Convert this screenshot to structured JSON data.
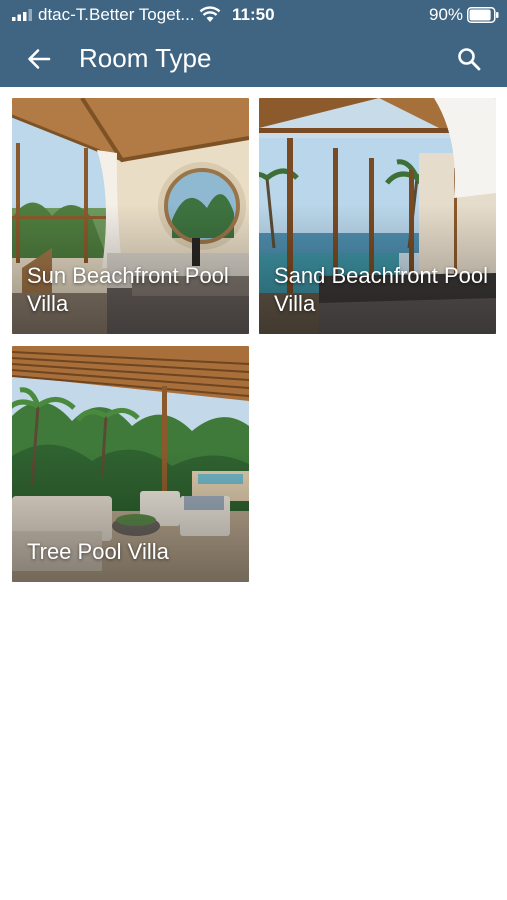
{
  "status_bar": {
    "carrier": "dtac-T.Better Toget...",
    "time": "11:50",
    "battery": "90%",
    "battery_level": 0.9
  },
  "header": {
    "title": "Room Type",
    "back_icon": "arrow-left-icon",
    "search_icon": "search-icon"
  },
  "colors": {
    "appbar": "#3f6583",
    "background": "#ffffff"
  },
  "rooms": [
    {
      "name": "Sun Beachfront Pool Villa"
    },
    {
      "name": "Sand Beachfront Pool Villa"
    },
    {
      "name": "Tree Pool Villa"
    }
  ]
}
